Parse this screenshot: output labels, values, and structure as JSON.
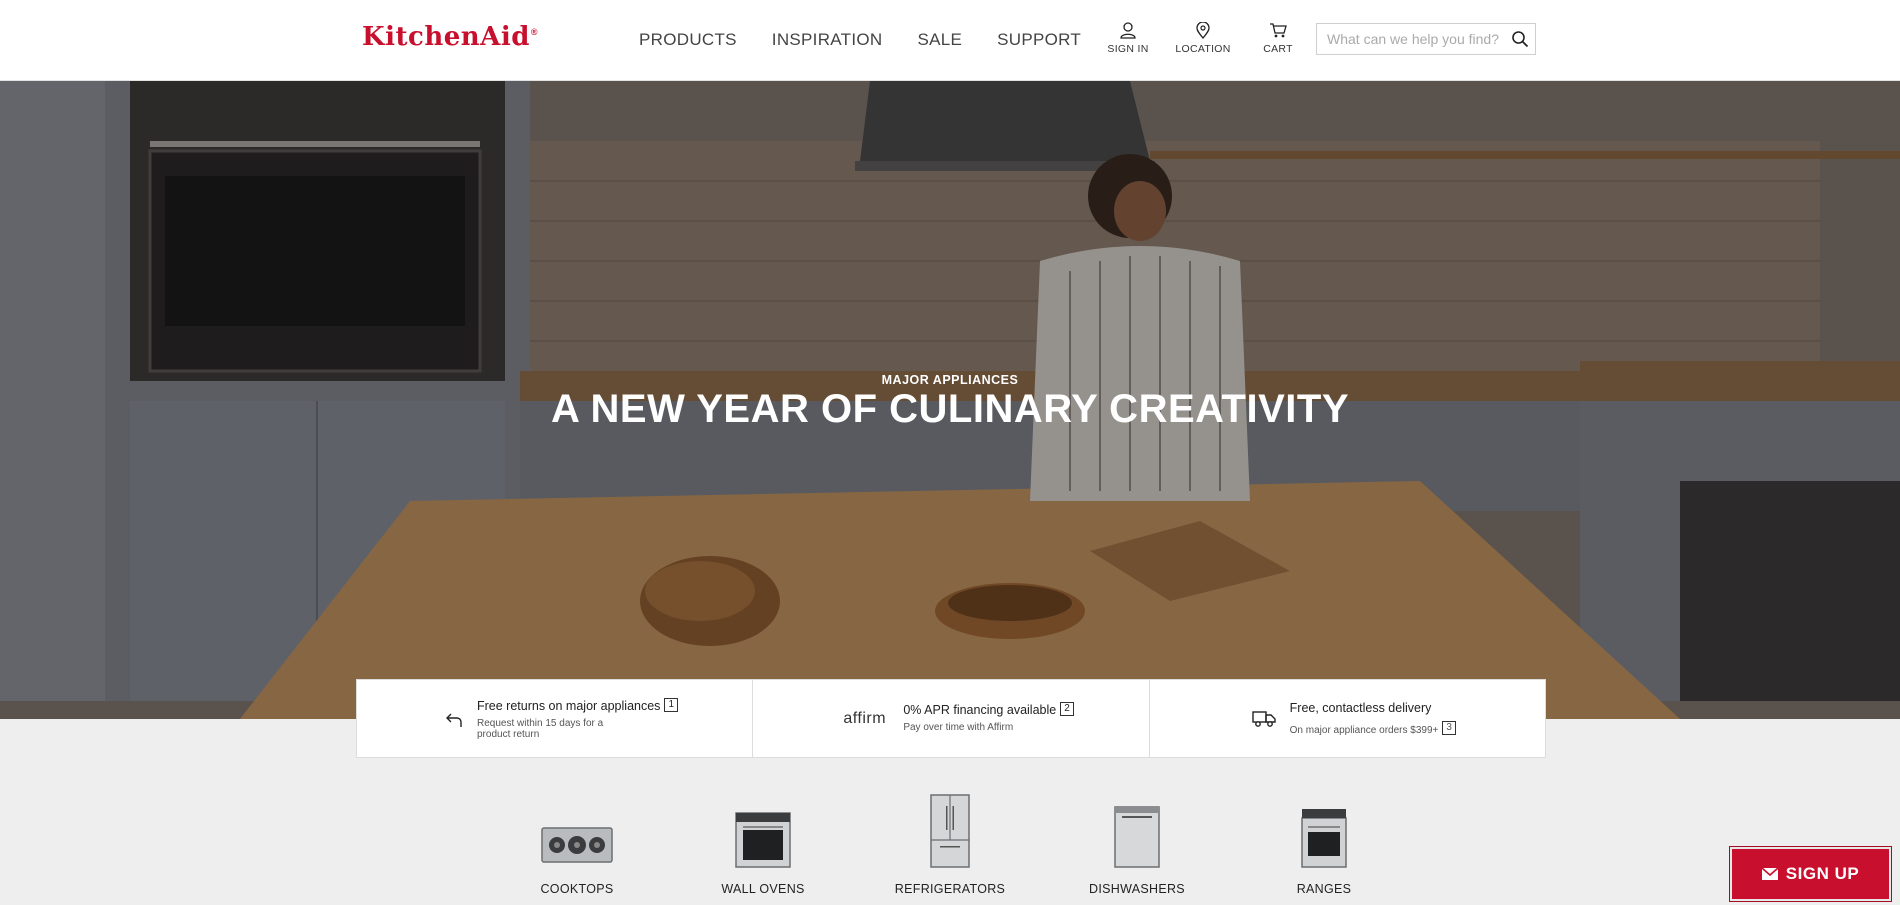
{
  "header": {
    "logo_text": "KitchenAid",
    "logo_mark": "®",
    "nav": [
      "PRODUCTS",
      "INSPIRATION",
      "SALE",
      "SUPPORT"
    ],
    "sign_in": "SIGN IN",
    "location": "LOCATION",
    "cart": "CART",
    "search_placeholder": "What can we help you find?"
  },
  "hero": {
    "eyebrow": "MAJOR APPLIANCES",
    "headline": "A NEW YEAR OF CULINARY CREATIVITY"
  },
  "benefits": [
    {
      "icon": "return-arrow-icon",
      "title": "Free returns on major appliances",
      "footnote": "1",
      "subtitle_line1": "Request within 15 days for a",
      "subtitle_line2": "product return"
    },
    {
      "icon": "affirm-logo",
      "logo_text": "affirm",
      "title": "0% APR financing available",
      "footnote": "2",
      "subtitle": "Pay over time with Affirm"
    },
    {
      "icon": "delivery-truck-icon",
      "title": "Free, contactless delivery",
      "subtitle": "On major appliance orders $399+",
      "footnote": "3"
    }
  ],
  "categories": [
    {
      "label": "COOKTOPS",
      "icon": "cooktop-image"
    },
    {
      "label": "WALL OVENS",
      "icon": "wall-oven-image"
    },
    {
      "label": "REFRIGERATORS",
      "icon": "refrigerator-image"
    },
    {
      "label": "DISHWASHERS",
      "icon": "dishwasher-image"
    },
    {
      "label": "RANGES",
      "icon": "range-image"
    }
  ],
  "signup": {
    "label": "SIGN UP",
    "icon": "mail-icon"
  },
  "colors": {
    "brand": "#c8102e",
    "background": "#eeeeee"
  }
}
